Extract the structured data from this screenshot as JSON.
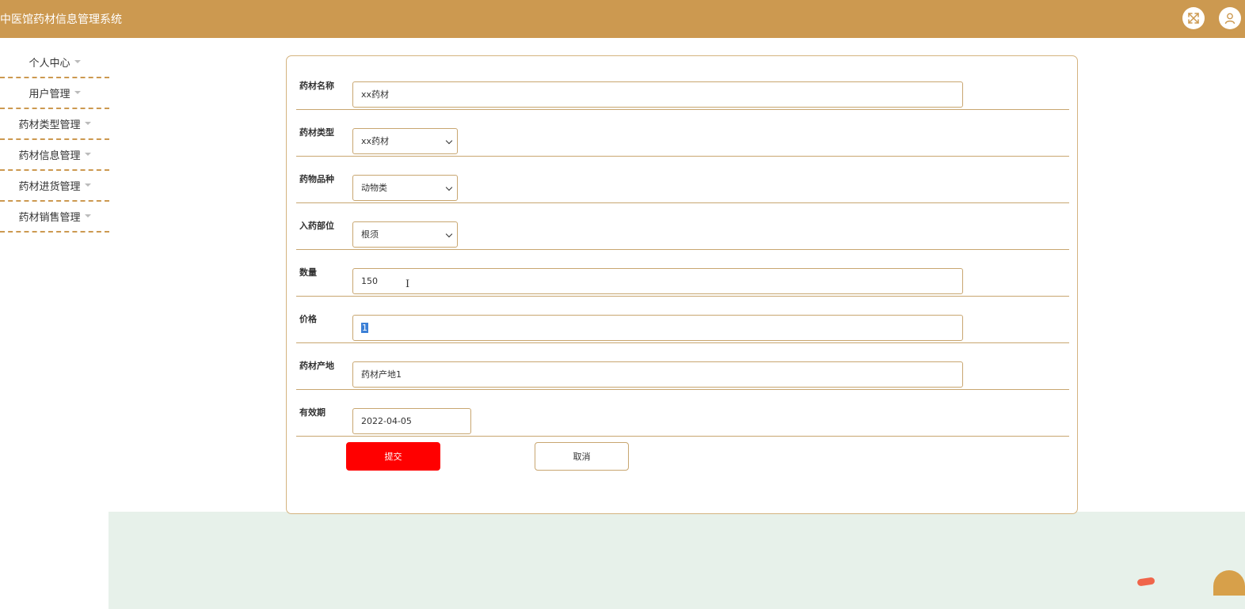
{
  "header": {
    "title": "中医馆药材信息管理系统"
  },
  "sidebar": {
    "items": [
      {
        "label": "个人中心"
      },
      {
        "label": "用户管理"
      },
      {
        "label": "药材类型管理"
      },
      {
        "label": "药材信息管理"
      },
      {
        "label": "药材进货管理"
      },
      {
        "label": "药材销售管理"
      }
    ]
  },
  "form": {
    "fields": [
      {
        "label": "药材名称",
        "value": "xx药材"
      },
      {
        "label": "药材类型",
        "value": "xx药材"
      },
      {
        "label": "药物品种",
        "value": "动物类"
      },
      {
        "label": "入药部位",
        "value": "根须"
      },
      {
        "label": "数量",
        "value": "150"
      },
      {
        "label": "价格",
        "value": "1"
      },
      {
        "label": "药材产地",
        "value": "药材产地1"
      },
      {
        "label": "有效期",
        "value": "2022-04-05"
      }
    ],
    "submit_label": "提交",
    "cancel_label": "取消"
  },
  "icons": {
    "fullscreen": "expand-icon",
    "user": "user-icon"
  },
  "colors": {
    "header_bg": "#cc9950",
    "accent_border": "#c8a670",
    "submit_bg": "#ff0000",
    "bottom_bg": "#e7f1ea"
  }
}
